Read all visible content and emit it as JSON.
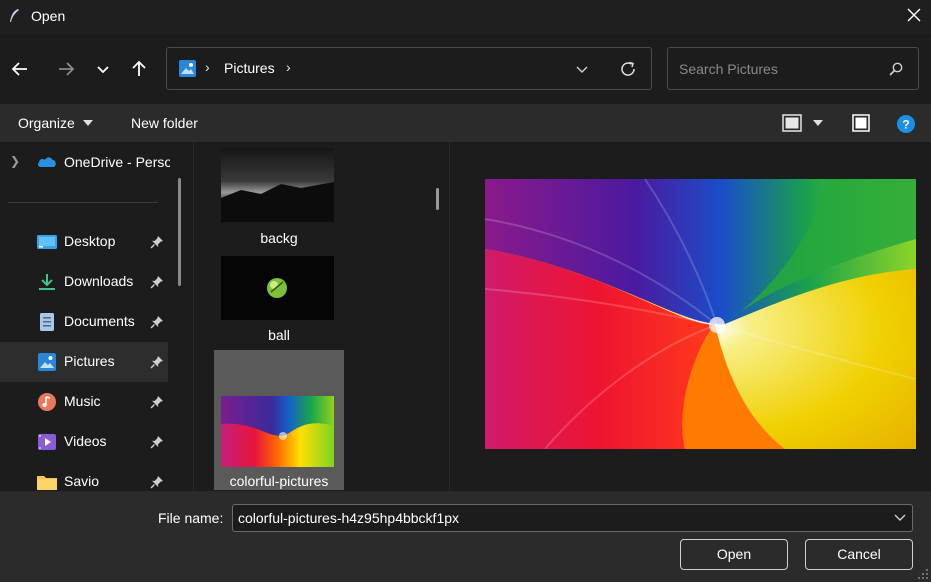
{
  "window": {
    "title": "Open"
  },
  "address": {
    "crumb": "Pictures",
    "chevron": "›"
  },
  "search": {
    "placeholder": "Search Pictures"
  },
  "command_bar": {
    "organize": "Organize",
    "new_folder": "New folder"
  },
  "nav": {
    "onedrive": "OneDrive - Personal",
    "items": [
      {
        "label": "Desktop",
        "icon": "desktop-icon"
      },
      {
        "label": "Downloads",
        "icon": "download-icon"
      },
      {
        "label": "Documents",
        "icon": "document-icon"
      },
      {
        "label": "Pictures",
        "icon": "pictures-icon",
        "selected": true
      },
      {
        "label": "Music",
        "icon": "music-icon"
      },
      {
        "label": "Videos",
        "icon": "video-icon"
      },
      {
        "label": "Savio",
        "icon": "folder-icon"
      }
    ]
  },
  "files": [
    {
      "name": "backg"
    },
    {
      "name": "ball"
    },
    {
      "name": "colorful-pictures",
      "selected": true
    }
  ],
  "bottom": {
    "filename_label": "File name:",
    "filename_value": "colorful-pictures-h4z95hp4bbckf1px",
    "open": "Open",
    "cancel": "Cancel"
  },
  "colors": {
    "background": "#1c1c1c",
    "bar": "#2b2b2b",
    "accent": "#1a8fe3",
    "selected": "#5a5a5a"
  }
}
